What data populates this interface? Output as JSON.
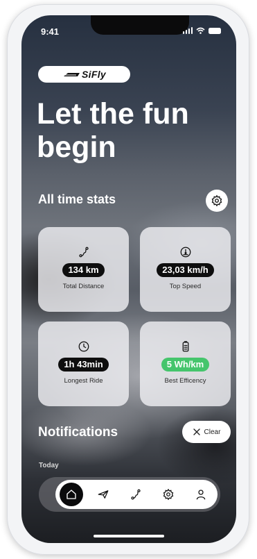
{
  "status": {
    "time": "9:41"
  },
  "brand": {
    "logo": "SiFly"
  },
  "headline": "Let the fun begin",
  "stats": {
    "title": "All time stats",
    "settings_icon": "gear-icon",
    "cards": [
      {
        "value": "134 km",
        "label": "Total Distance",
        "icon": "route-icon"
      },
      {
        "value": "23,03 km/h",
        "label": "Top Speed",
        "icon": "speedometer-icon"
      },
      {
        "value": "1h 43min",
        "label": "Longest Ride",
        "icon": "clock-icon"
      },
      {
        "value": "5 Wh/km",
        "label": "Best Efficency",
        "icon": "battery-icon",
        "highlight": "#45c56c"
      }
    ]
  },
  "notifications": {
    "title": "Notifications",
    "clear_label": "Clear",
    "section": "Today"
  },
  "tabbar": {
    "items": [
      {
        "icon": "home-icon",
        "active": true
      },
      {
        "icon": "send-icon",
        "active": false
      },
      {
        "icon": "route-icon",
        "active": false
      },
      {
        "icon": "gear-icon",
        "active": false
      },
      {
        "icon": "user-icon",
        "active": false
      }
    ]
  }
}
